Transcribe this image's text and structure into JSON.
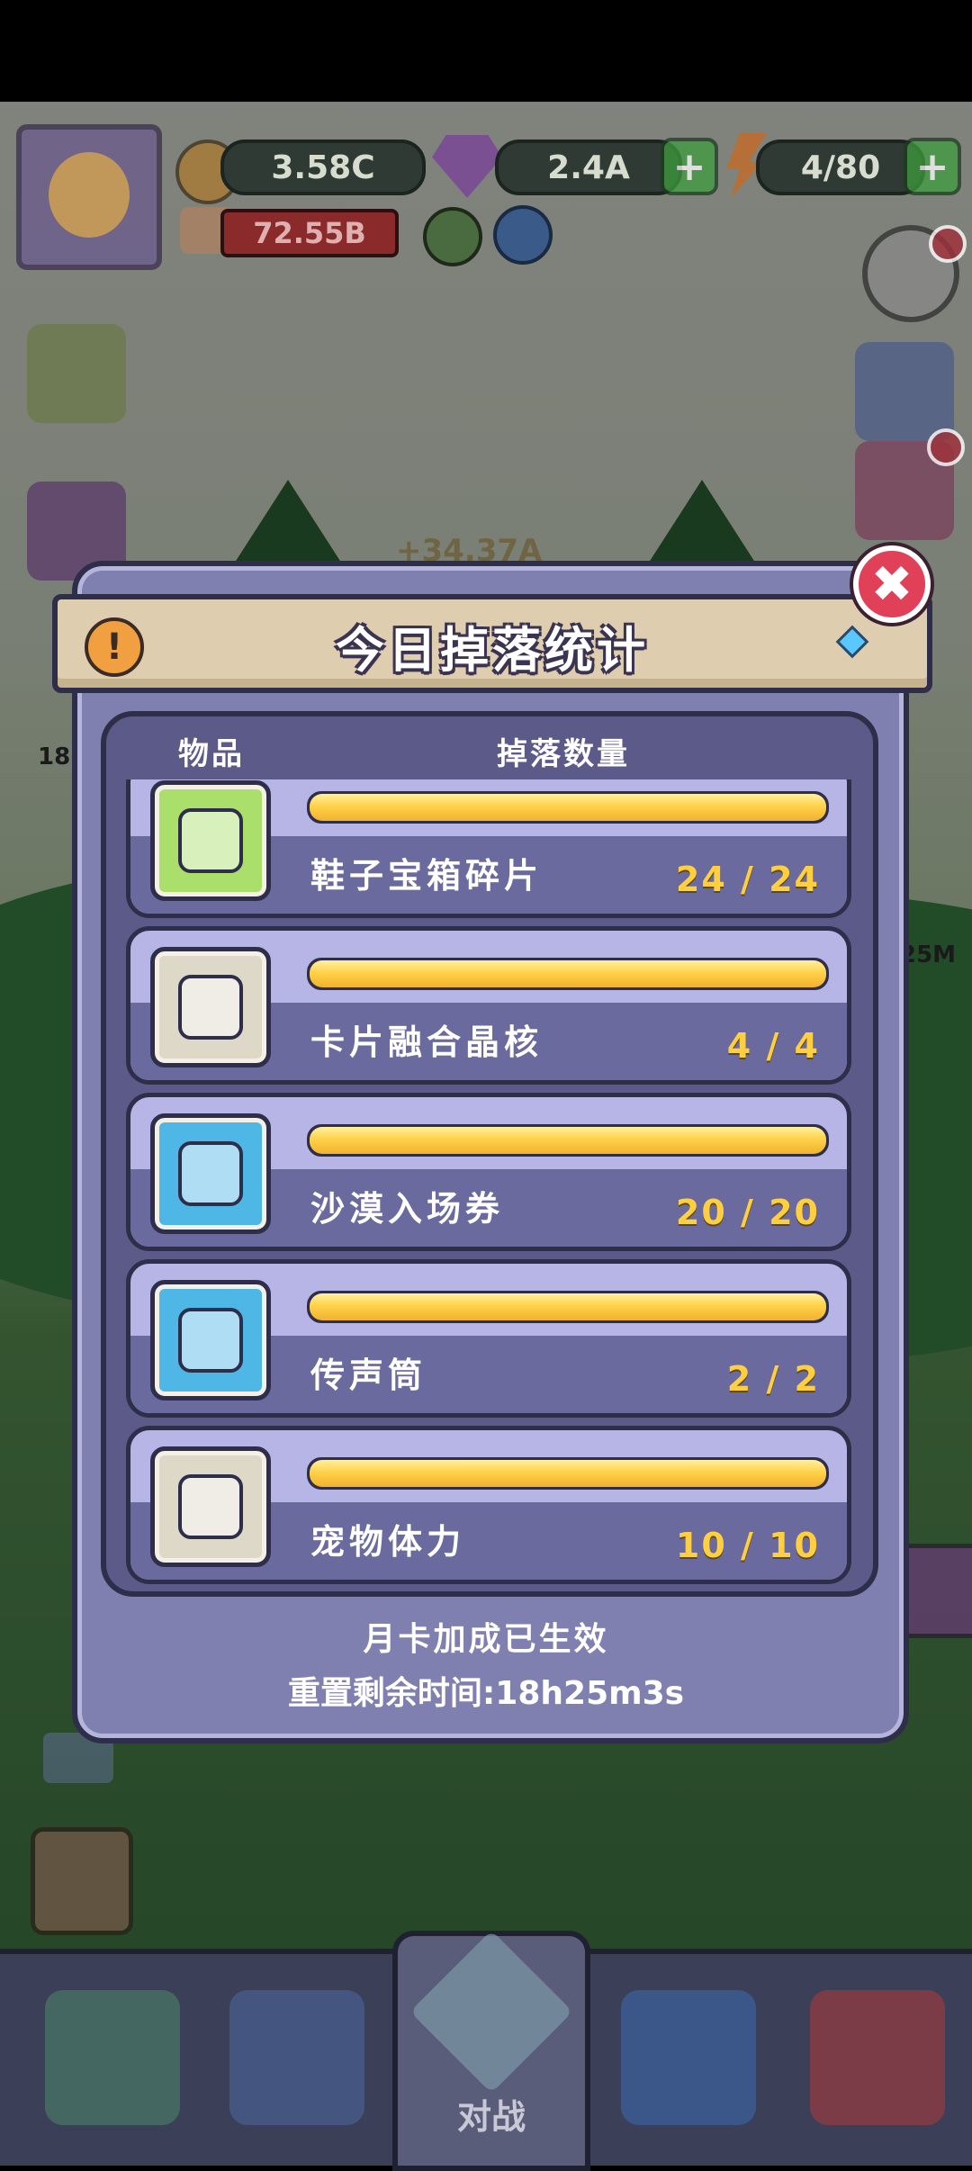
{
  "hud": {
    "gold": "3.58C",
    "gems": "2.4A",
    "energy": "4/80",
    "power": "72.55B",
    "plus_symbol": "+",
    "income_partial": "+34.37A",
    "side_value_1": "18",
    "side_value_2": "25M"
  },
  "dialog": {
    "title": "今日掉落统计",
    "close_symbol": "✖",
    "warning_symbol": "!",
    "header_item": "物品",
    "header_count": "掉落数量",
    "footer_status": "月卡加成已生效",
    "footer_reset": "重置剩余时间:18h25m3s"
  },
  "items": [
    {
      "name": "鞋子宝箱碎片",
      "count": "24 / 24",
      "progress": 1.0,
      "icon": "shoe-chest-fragment-icon",
      "tile_color": "#a9df6a"
    },
    {
      "name": "卡片融合晶核",
      "count": "4 / 4",
      "progress": 1.0,
      "icon": "fusion-crystal-icon",
      "tile_color": "#ddd8c8"
    },
    {
      "name": "沙漠入场券",
      "count": "20 / 20",
      "progress": 1.0,
      "icon": "desert-ticket-icon",
      "tile_color": "#4fb7e6"
    },
    {
      "name": "传声筒",
      "count": "2 / 2",
      "progress": 1.0,
      "icon": "megaphone-icon",
      "tile_color": "#4fb7e6"
    },
    {
      "name": "宠物体力",
      "count": "10 / 10",
      "progress": 1.0,
      "icon": "pet-stamina-potion-icon",
      "tile_color": "#ddd8c8"
    }
  ],
  "nav": {
    "battle_label": "对战"
  }
}
